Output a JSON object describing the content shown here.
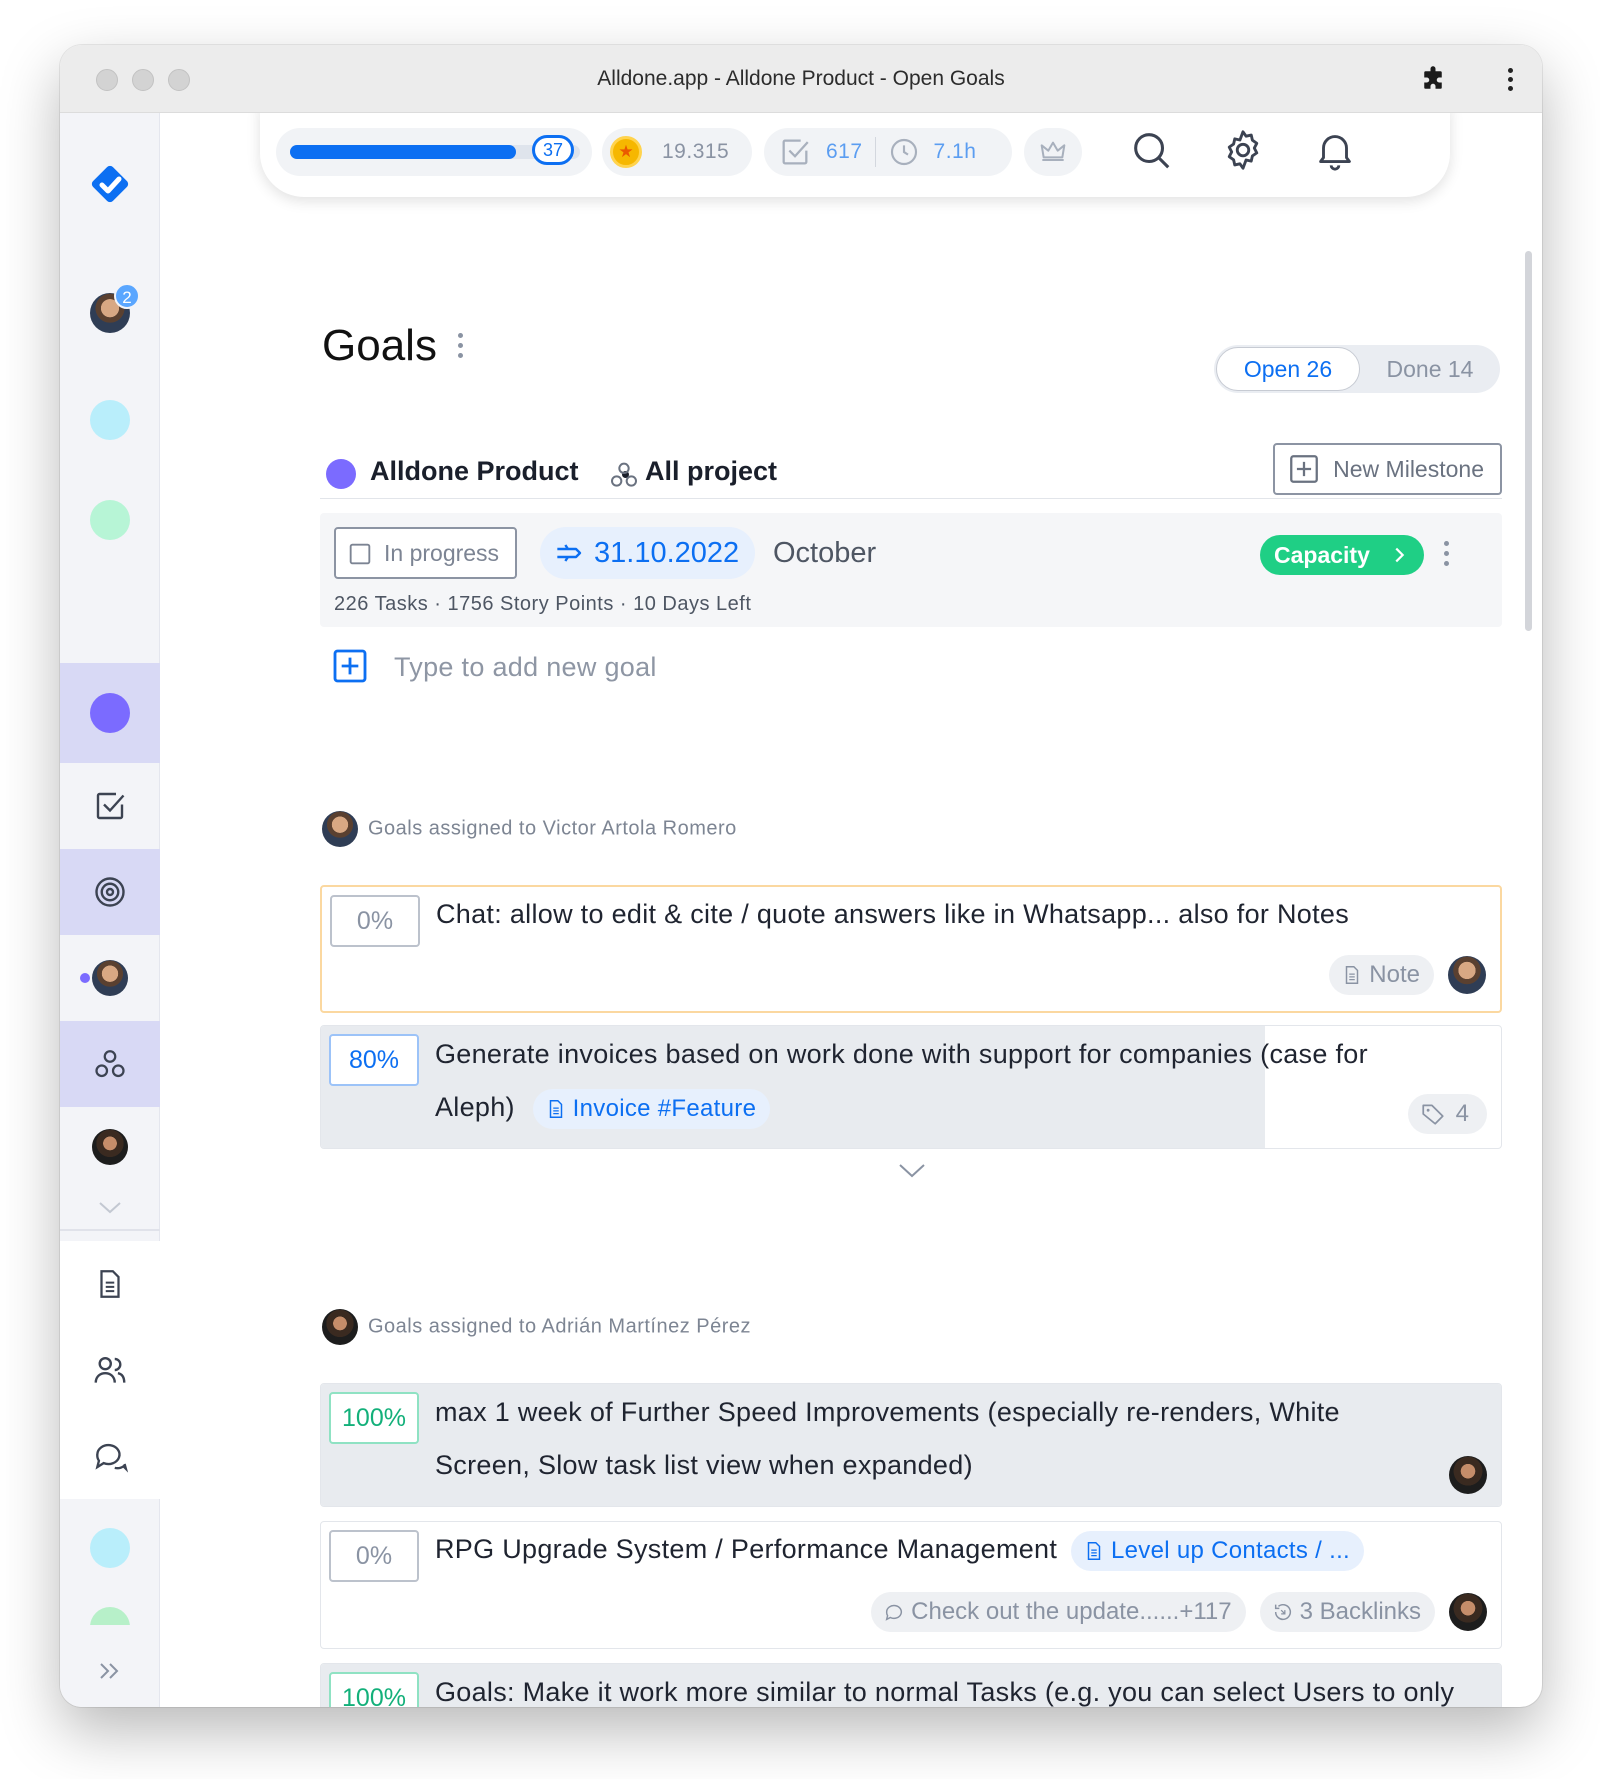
{
  "window": {
    "title": "Alldone.app - Alldone Product - Open Goals"
  },
  "sidebar": {
    "notification_count": "2"
  },
  "topbar": {
    "level": "37",
    "level_progress": 0.78,
    "gold": "19.315",
    "done_tasks": "617",
    "time": "7.1h"
  },
  "page": {
    "title": "Goals",
    "open_label": "Open 26",
    "done_label": "Done 14"
  },
  "project": {
    "name": "Alldone Product",
    "scope": "All project",
    "new_milestone_label": "New Milestone",
    "color": "#7b6bff"
  },
  "milestone": {
    "status": "In progress",
    "date": "31.10.2022",
    "name": "October",
    "meta": "226 Tasks · 1756 Story Points · 10 Days Left",
    "capacity_label": "Capacity"
  },
  "add_goal": {
    "placeholder": "Type to add new goal"
  },
  "sections": [
    {
      "heading": "Goals assigned to Victor Artola Romero",
      "goals": [
        {
          "progress": "0%",
          "text": "Chat: allow to edit & cite / quote answers like in Whatsapp... also for Notes",
          "note_label": "Note"
        },
        {
          "progress": "80%",
          "text": "Generate invoices based on work done with support for companies (case for Aleph)",
          "note_chip": "Invoice #Feature",
          "tag_count": "4",
          "fill": 0.8
        }
      ]
    },
    {
      "heading": "Goals assigned to Adrián Martínez Pérez",
      "goals": [
        {
          "progress": "100%",
          "text": "max 1 week of Further Speed Improvements (especially re-renders, White Screen, Slow task list view when expanded)",
          "fill": 1.0
        },
        {
          "progress": "0%",
          "text": "RPG Upgrade System / Performance Management",
          "note_chip": "Level up Contacts / ...",
          "comment_label": "Check out the update......+117",
          "backlinks_label": "3 Backlinks"
        },
        {
          "progress": "100%",
          "text": "Goals: Make it work more similar to normal Tasks (e.g. you can select Users to only see their goals, add Goals directly to certain users etc.)",
          "fill": 1.0
        }
      ]
    }
  ],
  "colors": {
    "accent": "#0c6ff2",
    "capacity": "#1fcf85",
    "highlight_border": "#fbd8a0"
  }
}
